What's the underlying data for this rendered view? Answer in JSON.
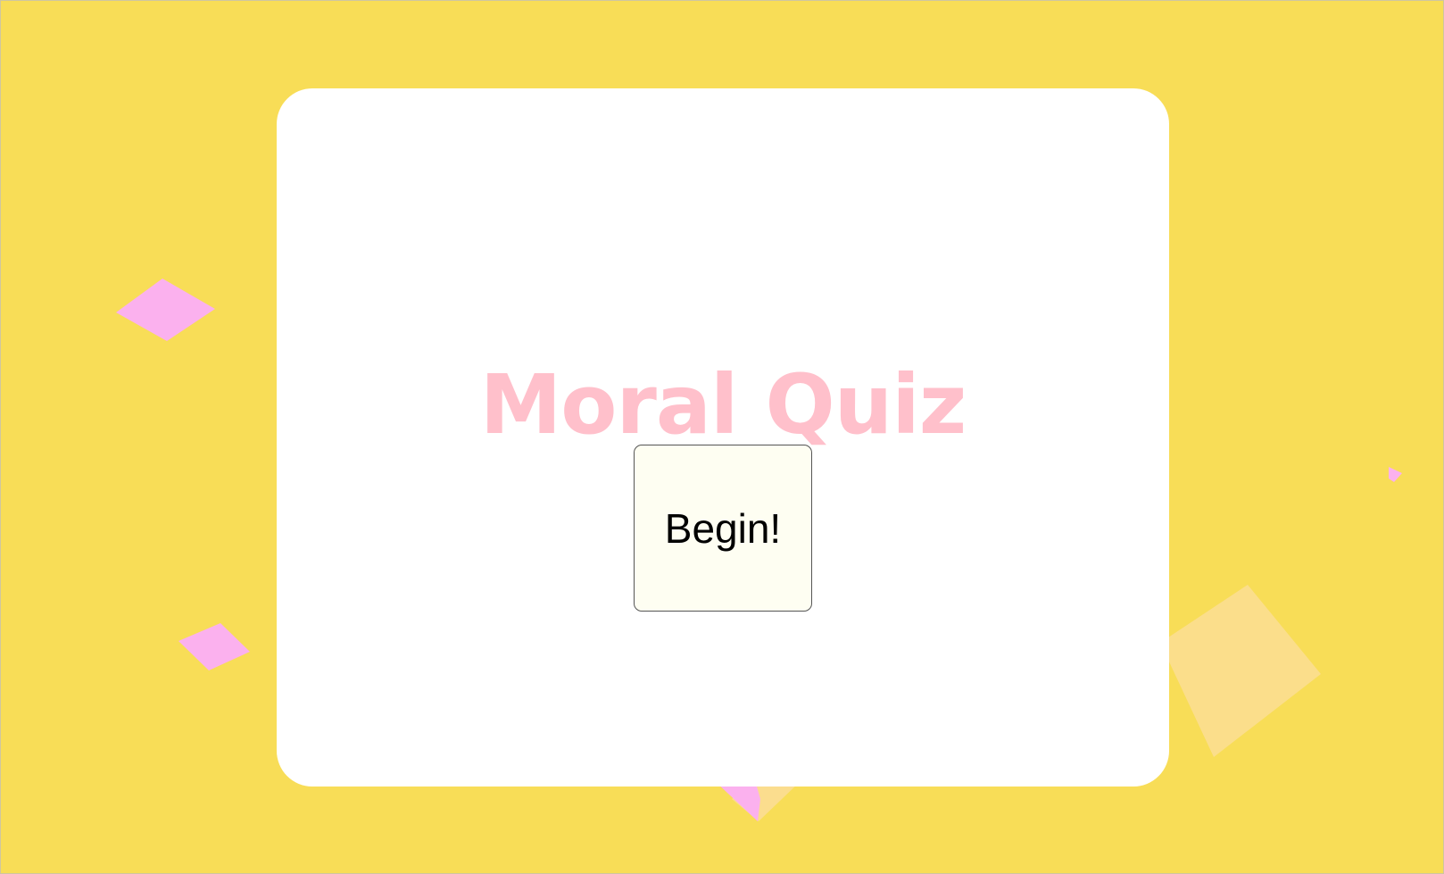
{
  "page": {
    "title": "Moral Quiz",
    "begin_label": "Begin!"
  },
  "colors": {
    "background": "#f8dd57",
    "card": "#ffffff",
    "title": "#ffc0cb",
    "button_bg": "#fefef2",
    "confetti_pink": "#fbb1ee",
    "confetti_cream": "#fbdd8e"
  },
  "decorations": [
    "confetti-diamond-pink",
    "confetti-diamond-cream"
  ]
}
